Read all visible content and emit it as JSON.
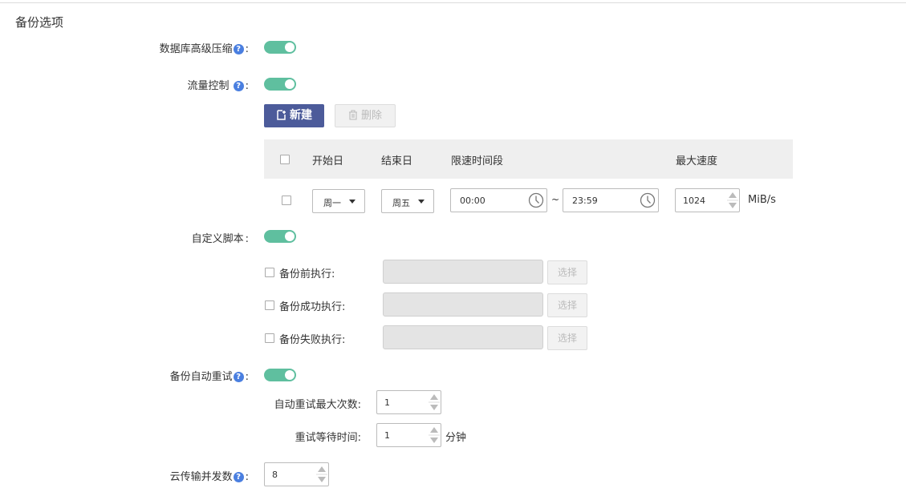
{
  "section_title": "备份选项",
  "db_compression": {
    "label": "数据库高级压缩",
    "enabled": true
  },
  "flow_control": {
    "label": "流量控制",
    "enabled": true,
    "new_button": "新建",
    "delete_button": "删除",
    "columns": [
      "开始日",
      "结束日",
      "限速时间段",
      "最大速度"
    ],
    "rows": [
      {
        "start_day": "周一",
        "end_day": "周五",
        "time_from": "00:00",
        "time_sep": "~",
        "time_to": "23:59",
        "max_speed": "1024",
        "unit": "MiB/s"
      }
    ]
  },
  "custom_script": {
    "label": "自定义脚本",
    "enabled": true,
    "items": [
      {
        "label": "备份前执行:",
        "button": "选择",
        "value": ""
      },
      {
        "label": "备份成功执行:",
        "button": "选择",
        "value": ""
      },
      {
        "label": "备份失败执行:",
        "button": "选择",
        "value": ""
      }
    ]
  },
  "auto_retry": {
    "label": "备份自动重试",
    "enabled": true,
    "max_retries_label": "自动重试最大次数:",
    "max_retries": "1",
    "wait_label": "重试等待时间:",
    "wait_value": "1",
    "wait_unit": "分钟"
  },
  "cloud_concurrency": {
    "label": "云传输并发数",
    "value": "8"
  },
  "colors": {
    "toggle_on": "#5fbf9f",
    "primary_button": "#4c5b9a",
    "help_icon": "#4a7fe0"
  }
}
